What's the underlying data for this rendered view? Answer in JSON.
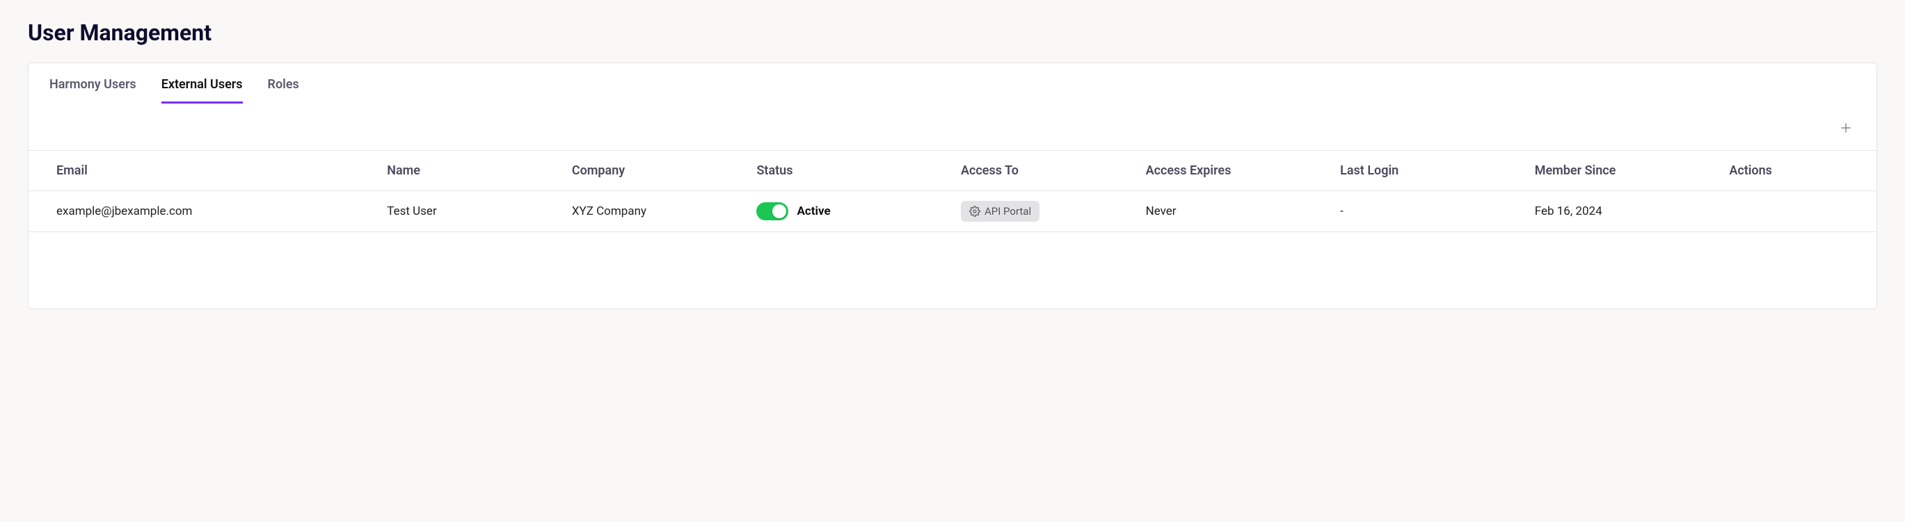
{
  "page_title": "User Management",
  "tabs": [
    {
      "label": "Harmony Users",
      "active": false
    },
    {
      "label": "External Users",
      "active": true
    },
    {
      "label": "Roles",
      "active": false
    }
  ],
  "columns": {
    "email": "Email",
    "name": "Name",
    "company": "Company",
    "status": "Status",
    "access_to": "Access To",
    "access_expires": "Access Expires",
    "last_login": "Last Login",
    "member_since": "Member Since",
    "actions": "Actions"
  },
  "rows": [
    {
      "email": "example@jbexample.com",
      "name": "Test User",
      "company": "XYZ Company",
      "status_on": true,
      "status_label": "Active",
      "access_to": "API Portal",
      "access_expires": "Never",
      "last_login": "-",
      "member_since": "Feb 16, 2024"
    }
  ]
}
